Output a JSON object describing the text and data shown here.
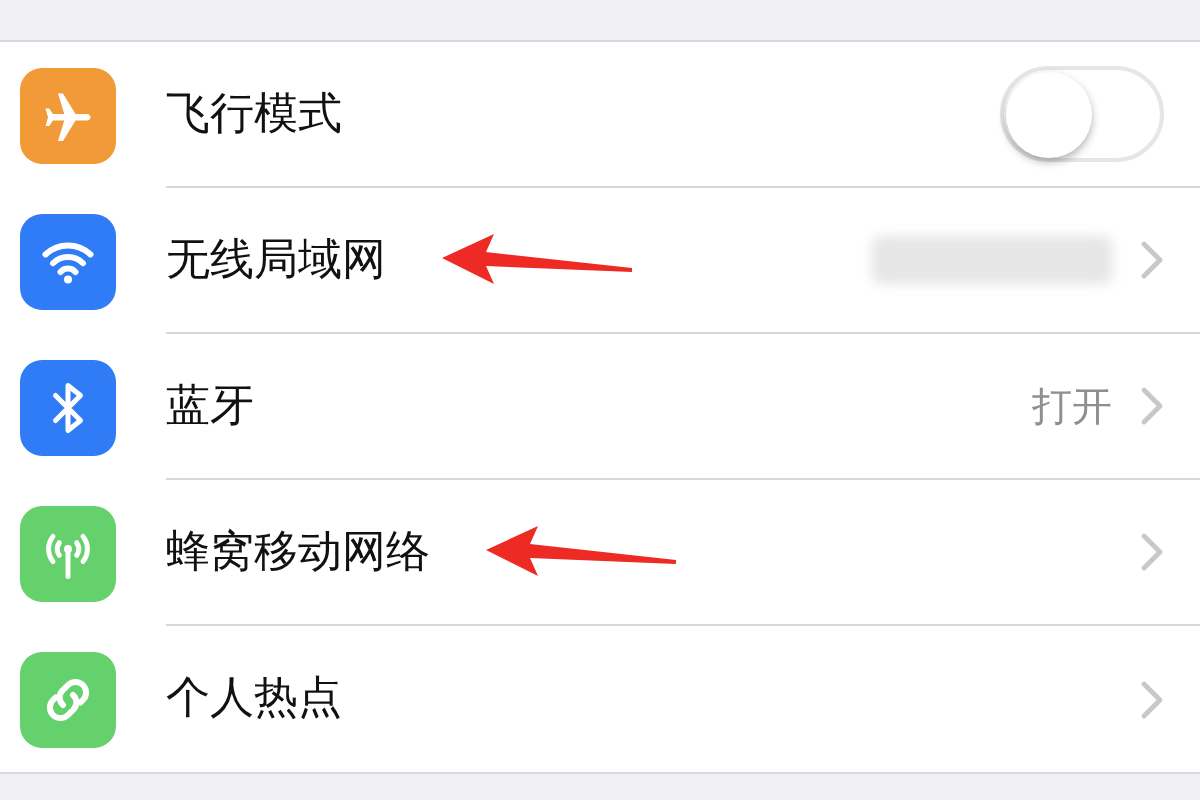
{
  "settings": [
    {
      "kind": "toggle",
      "label": "飞行模式",
      "on": false,
      "annotated": false
    },
    {
      "kind": "link",
      "label": "无线局域网",
      "redacted": true,
      "annotated": true
    },
    {
      "kind": "link",
      "label": "蓝牙",
      "value": "打开",
      "annotated": false
    },
    {
      "kind": "link",
      "label": "蜂窝移动网络",
      "annotated": true
    },
    {
      "kind": "link",
      "label": "个人热点",
      "annotated": false
    }
  ]
}
